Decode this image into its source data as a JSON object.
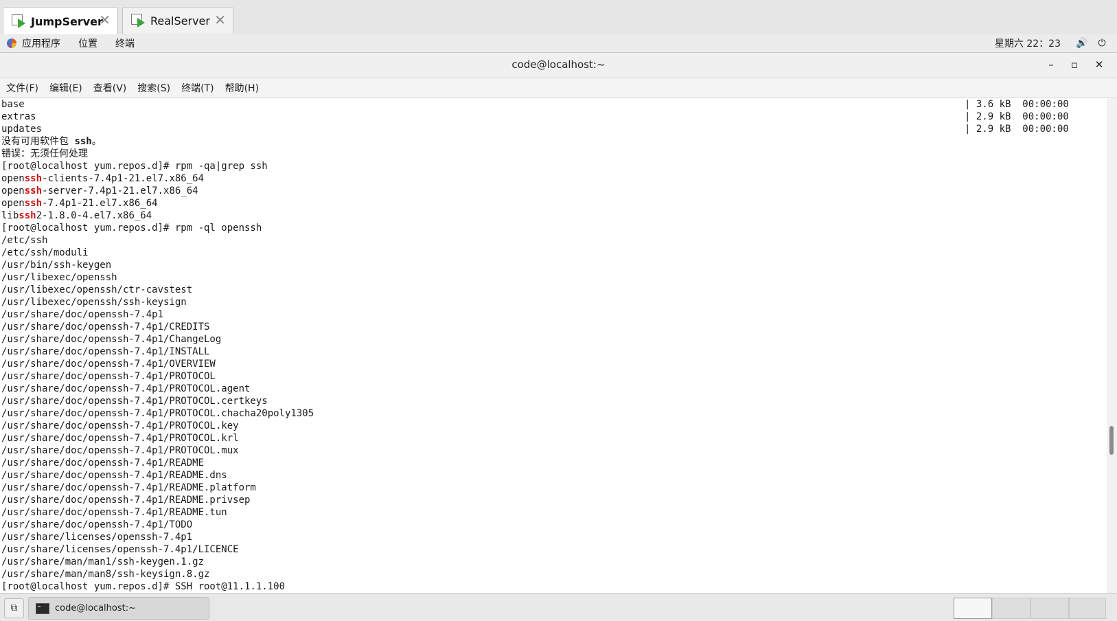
{
  "tabs": [
    {
      "label": "JumpServer",
      "active": true
    },
    {
      "label": "RealServer",
      "active": false
    }
  ],
  "gnome_bar": {
    "applications": "应用程序",
    "places": "位置",
    "terminal": "终端",
    "clock": "星期六 22：23",
    "volume_icon": "🔊",
    "power_icon": "⏻"
  },
  "window": {
    "title": "code@localhost:~",
    "minimize": "–",
    "maximize": "▫",
    "close": "✕"
  },
  "menu": [
    "文件(F)",
    "编辑(E)",
    "查看(V)",
    "搜索(S)",
    "终端(T)",
    "帮助(H)"
  ],
  "terminal": {
    "lines": [
      [
        {
          "t": "base"
        }
      ],
      [
        {
          "t": "extras"
        }
      ],
      [
        {
          "t": "updates"
        }
      ],
      [
        {
          "t": "没有可用软件包 "
        },
        {
          "t": "ssh",
          "c": "bold"
        },
        {
          "t": "。"
        }
      ],
      [
        {
          "t": "错误：无须任何处理"
        }
      ],
      [
        {
          "t": "[root@localhost yum.repos.d]# rpm -qa|grep ssh"
        }
      ],
      [
        {
          "t": "open"
        },
        {
          "t": "ssh",
          "c": "hl"
        },
        {
          "t": "-clients-7.4p1-21.el7.x86_64"
        }
      ],
      [
        {
          "t": "open"
        },
        {
          "t": "ssh",
          "c": "hl"
        },
        {
          "t": "-server-7.4p1-21.el7.x86_64"
        }
      ],
      [
        {
          "t": "open"
        },
        {
          "t": "ssh",
          "c": "hl"
        },
        {
          "t": "-7.4p1-21.el7.x86_64"
        }
      ],
      [
        {
          "t": "lib"
        },
        {
          "t": "ssh",
          "c": "hl"
        },
        {
          "t": "2-1.8.0-4.el7.x86_64"
        }
      ],
      [
        {
          "t": "[root@localhost yum.repos.d]# rpm -ql openssh"
        }
      ],
      [
        {
          "t": "/etc/ssh"
        }
      ],
      [
        {
          "t": "/etc/ssh/moduli"
        }
      ],
      [
        {
          "t": "/usr/bin/ssh-keygen"
        }
      ],
      [
        {
          "t": "/usr/libexec/openssh"
        }
      ],
      [
        {
          "t": "/usr/libexec/openssh/ctr-cavstest"
        }
      ],
      [
        {
          "t": "/usr/libexec/openssh/ssh-keysign"
        }
      ],
      [
        {
          "t": "/usr/share/doc/openssh-7.4p1"
        }
      ],
      [
        {
          "t": "/usr/share/doc/openssh-7.4p1/CREDITS"
        }
      ],
      [
        {
          "t": "/usr/share/doc/openssh-7.4p1/ChangeLog"
        }
      ],
      [
        {
          "t": "/usr/share/doc/openssh-7.4p1/INSTALL"
        }
      ],
      [
        {
          "t": "/usr/share/doc/openssh-7.4p1/OVERVIEW"
        }
      ],
      [
        {
          "t": "/usr/share/doc/openssh-7.4p1/PROTOCOL"
        }
      ],
      [
        {
          "t": "/usr/share/doc/openssh-7.4p1/PROTOCOL.agent"
        }
      ],
      [
        {
          "t": "/usr/share/doc/openssh-7.4p1/PROTOCOL.certkeys"
        }
      ],
      [
        {
          "t": "/usr/share/doc/openssh-7.4p1/PROTOCOL.chacha20poly1305"
        }
      ],
      [
        {
          "t": "/usr/share/doc/openssh-7.4p1/PROTOCOL.key"
        }
      ],
      [
        {
          "t": "/usr/share/doc/openssh-7.4p1/PROTOCOL.krl"
        }
      ],
      [
        {
          "t": "/usr/share/doc/openssh-7.4p1/PROTOCOL.mux"
        }
      ],
      [
        {
          "t": "/usr/share/doc/openssh-7.4p1/README"
        }
      ],
      [
        {
          "t": "/usr/share/doc/openssh-7.4p1/README.dns"
        }
      ],
      [
        {
          "t": "/usr/share/doc/openssh-7.4p1/README.platform"
        }
      ],
      [
        {
          "t": "/usr/share/doc/openssh-7.4p1/README.privsep"
        }
      ],
      [
        {
          "t": "/usr/share/doc/openssh-7.4p1/README.tun"
        }
      ],
      [
        {
          "t": "/usr/share/doc/openssh-7.4p1/TODO"
        }
      ],
      [
        {
          "t": "/usr/share/licenses/openssh-7.4p1"
        }
      ],
      [
        {
          "t": "/usr/share/licenses/openssh-7.4p1/LICENCE"
        }
      ],
      [
        {
          "t": "/usr/share/man/man1/ssh-keygen.1.gz"
        }
      ],
      [
        {
          "t": "/usr/share/man/man8/ssh-keysign.8.gz"
        }
      ],
      [
        {
          "t": "[root@localhost yum.repos.d]# SSH root@11.1.1.100"
        }
      ]
    ],
    "repo_status": [
      "| 3.6 kB  00:00:00",
      "| 2.9 kB  00:00:00",
      "| 2.9 kB  00:00:00"
    ]
  },
  "taskbar": {
    "show_desktop_icon": "⧉",
    "window_label": "code@localhost:~",
    "workspaces": 4,
    "active_workspace": 1
  }
}
